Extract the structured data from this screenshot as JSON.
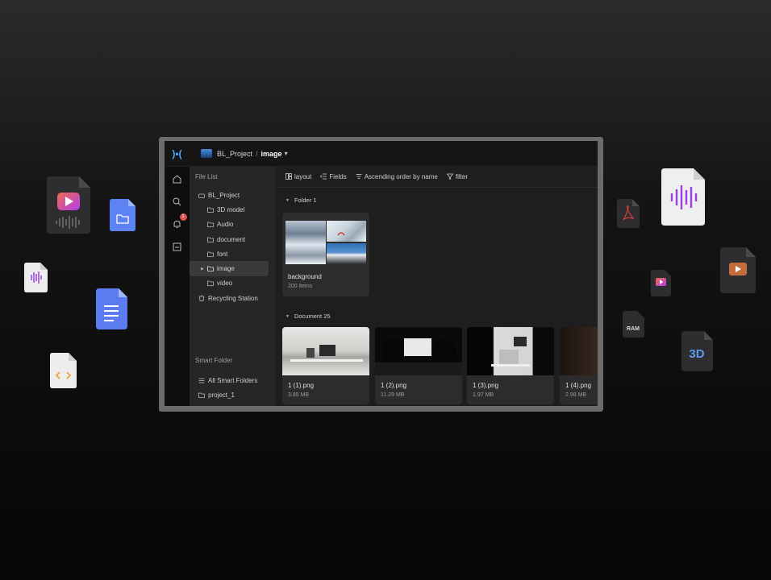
{
  "app": {
    "logo": ")•(",
    "project": "BL_Project",
    "separator": "/",
    "current_folder": "image",
    "notification_count": "1"
  },
  "sidebar": {
    "file_list_label": "File List",
    "tree": [
      {
        "label": "BL_Project",
        "level": "root",
        "icon": "drive-icon"
      },
      {
        "label": "3D model",
        "level": "child",
        "icon": "folder-icon"
      },
      {
        "label": "Audio",
        "level": "child",
        "icon": "folder-icon"
      },
      {
        "label": "document",
        "level": "child",
        "icon": "folder-icon"
      },
      {
        "label": "font",
        "level": "child",
        "icon": "folder-icon"
      },
      {
        "label": "image",
        "level": "child",
        "icon": "folder-icon",
        "selected": true
      },
      {
        "label": "video",
        "level": "child",
        "icon": "folder-icon"
      },
      {
        "label": "Recycling Station",
        "level": "root",
        "icon": "trash-icon"
      }
    ],
    "smart_folder_label": "Smart Folder",
    "smart_items": [
      {
        "label": "All Smart Folders",
        "icon": "list-icon"
      },
      {
        "label": "project_1",
        "icon": "smart-folder-icon"
      }
    ]
  },
  "toolbar": {
    "layout": "layout",
    "fields": "Fields",
    "sort": "Ascending order by name",
    "filter": "filter"
  },
  "groups": {
    "folder_group": "Folder 1",
    "document_group": "Document 25"
  },
  "folder": {
    "name": "background",
    "count": "200 items"
  },
  "files": [
    {
      "name": "1 (1).png",
      "size": "3.85 MB"
    },
    {
      "name": "1 (2).png",
      "size": "11.29 MB"
    },
    {
      "name": "1 (3).png",
      "size": "1.97 MB"
    },
    {
      "name": "1 (4).png",
      "size": "2.98 MB"
    }
  ],
  "floating_icons": {
    "ram_label": "RAM",
    "threed_label": "3D"
  },
  "colors": {
    "accent": "#4ea7ff",
    "badge": "#e05252",
    "video_gradient": "#e64a7a",
    "audio_purple": "#9b3fe0",
    "doc_blue": "#5b7cf0"
  }
}
